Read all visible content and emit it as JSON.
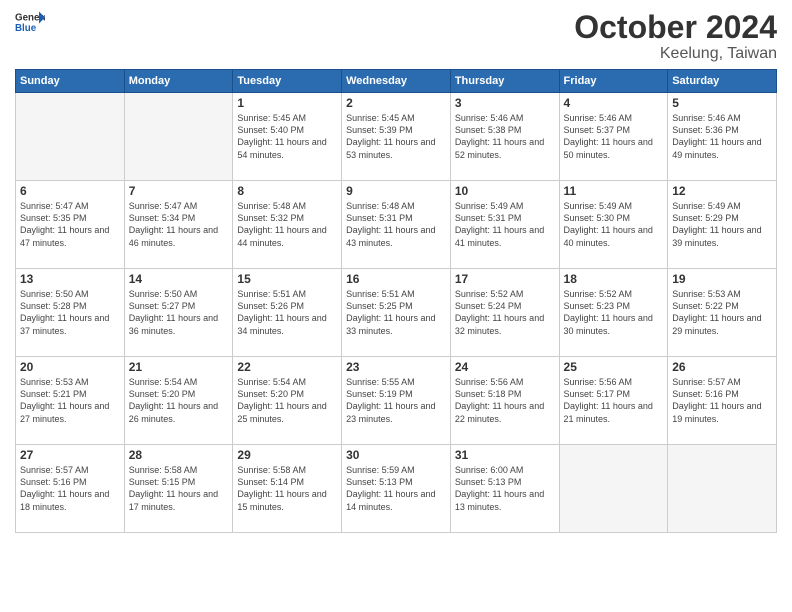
{
  "header": {
    "logo_general": "General",
    "logo_blue": "Blue",
    "month": "October 2024",
    "location": "Keelung, Taiwan"
  },
  "days_of_week": [
    "Sunday",
    "Monday",
    "Tuesday",
    "Wednesday",
    "Thursday",
    "Friday",
    "Saturday"
  ],
  "weeks": [
    [
      {
        "day": "",
        "sunrise": "",
        "sunset": "",
        "daylight": "",
        "empty": true
      },
      {
        "day": "",
        "sunrise": "",
        "sunset": "",
        "daylight": "",
        "empty": true
      },
      {
        "day": "1",
        "sunrise": "Sunrise: 5:45 AM",
        "sunset": "Sunset: 5:40 PM",
        "daylight": "Daylight: 11 hours and 54 minutes.",
        "empty": false
      },
      {
        "day": "2",
        "sunrise": "Sunrise: 5:45 AM",
        "sunset": "Sunset: 5:39 PM",
        "daylight": "Daylight: 11 hours and 53 minutes.",
        "empty": false
      },
      {
        "day": "3",
        "sunrise": "Sunrise: 5:46 AM",
        "sunset": "Sunset: 5:38 PM",
        "daylight": "Daylight: 11 hours and 52 minutes.",
        "empty": false
      },
      {
        "day": "4",
        "sunrise": "Sunrise: 5:46 AM",
        "sunset": "Sunset: 5:37 PM",
        "daylight": "Daylight: 11 hours and 50 minutes.",
        "empty": false
      },
      {
        "day": "5",
        "sunrise": "Sunrise: 5:46 AM",
        "sunset": "Sunset: 5:36 PM",
        "daylight": "Daylight: 11 hours and 49 minutes.",
        "empty": false
      }
    ],
    [
      {
        "day": "6",
        "sunrise": "Sunrise: 5:47 AM",
        "sunset": "Sunset: 5:35 PM",
        "daylight": "Daylight: 11 hours and 47 minutes.",
        "empty": false
      },
      {
        "day": "7",
        "sunrise": "Sunrise: 5:47 AM",
        "sunset": "Sunset: 5:34 PM",
        "daylight": "Daylight: 11 hours and 46 minutes.",
        "empty": false
      },
      {
        "day": "8",
        "sunrise": "Sunrise: 5:48 AM",
        "sunset": "Sunset: 5:32 PM",
        "daylight": "Daylight: 11 hours and 44 minutes.",
        "empty": false
      },
      {
        "day": "9",
        "sunrise": "Sunrise: 5:48 AM",
        "sunset": "Sunset: 5:31 PM",
        "daylight": "Daylight: 11 hours and 43 minutes.",
        "empty": false
      },
      {
        "day": "10",
        "sunrise": "Sunrise: 5:49 AM",
        "sunset": "Sunset: 5:31 PM",
        "daylight": "Daylight: 11 hours and 41 minutes.",
        "empty": false
      },
      {
        "day": "11",
        "sunrise": "Sunrise: 5:49 AM",
        "sunset": "Sunset: 5:30 PM",
        "daylight": "Daylight: 11 hours and 40 minutes.",
        "empty": false
      },
      {
        "day": "12",
        "sunrise": "Sunrise: 5:49 AM",
        "sunset": "Sunset: 5:29 PM",
        "daylight": "Daylight: 11 hours and 39 minutes.",
        "empty": false
      }
    ],
    [
      {
        "day": "13",
        "sunrise": "Sunrise: 5:50 AM",
        "sunset": "Sunset: 5:28 PM",
        "daylight": "Daylight: 11 hours and 37 minutes.",
        "empty": false
      },
      {
        "day": "14",
        "sunrise": "Sunrise: 5:50 AM",
        "sunset": "Sunset: 5:27 PM",
        "daylight": "Daylight: 11 hours and 36 minutes.",
        "empty": false
      },
      {
        "day": "15",
        "sunrise": "Sunrise: 5:51 AM",
        "sunset": "Sunset: 5:26 PM",
        "daylight": "Daylight: 11 hours and 34 minutes.",
        "empty": false
      },
      {
        "day": "16",
        "sunrise": "Sunrise: 5:51 AM",
        "sunset": "Sunset: 5:25 PM",
        "daylight": "Daylight: 11 hours and 33 minutes.",
        "empty": false
      },
      {
        "day": "17",
        "sunrise": "Sunrise: 5:52 AM",
        "sunset": "Sunset: 5:24 PM",
        "daylight": "Daylight: 11 hours and 32 minutes.",
        "empty": false
      },
      {
        "day": "18",
        "sunrise": "Sunrise: 5:52 AM",
        "sunset": "Sunset: 5:23 PM",
        "daylight": "Daylight: 11 hours and 30 minutes.",
        "empty": false
      },
      {
        "day": "19",
        "sunrise": "Sunrise: 5:53 AM",
        "sunset": "Sunset: 5:22 PM",
        "daylight": "Daylight: 11 hours and 29 minutes.",
        "empty": false
      }
    ],
    [
      {
        "day": "20",
        "sunrise": "Sunrise: 5:53 AM",
        "sunset": "Sunset: 5:21 PM",
        "daylight": "Daylight: 11 hours and 27 minutes.",
        "empty": false
      },
      {
        "day": "21",
        "sunrise": "Sunrise: 5:54 AM",
        "sunset": "Sunset: 5:20 PM",
        "daylight": "Daylight: 11 hours and 26 minutes.",
        "empty": false
      },
      {
        "day": "22",
        "sunrise": "Sunrise: 5:54 AM",
        "sunset": "Sunset: 5:20 PM",
        "daylight": "Daylight: 11 hours and 25 minutes.",
        "empty": false
      },
      {
        "day": "23",
        "sunrise": "Sunrise: 5:55 AM",
        "sunset": "Sunset: 5:19 PM",
        "daylight": "Daylight: 11 hours and 23 minutes.",
        "empty": false
      },
      {
        "day": "24",
        "sunrise": "Sunrise: 5:56 AM",
        "sunset": "Sunset: 5:18 PM",
        "daylight": "Daylight: 11 hours and 22 minutes.",
        "empty": false
      },
      {
        "day": "25",
        "sunrise": "Sunrise: 5:56 AM",
        "sunset": "Sunset: 5:17 PM",
        "daylight": "Daylight: 11 hours and 21 minutes.",
        "empty": false
      },
      {
        "day": "26",
        "sunrise": "Sunrise: 5:57 AM",
        "sunset": "Sunset: 5:16 PM",
        "daylight": "Daylight: 11 hours and 19 minutes.",
        "empty": false
      }
    ],
    [
      {
        "day": "27",
        "sunrise": "Sunrise: 5:57 AM",
        "sunset": "Sunset: 5:16 PM",
        "daylight": "Daylight: 11 hours and 18 minutes.",
        "empty": false
      },
      {
        "day": "28",
        "sunrise": "Sunrise: 5:58 AM",
        "sunset": "Sunset: 5:15 PM",
        "daylight": "Daylight: 11 hours and 17 minutes.",
        "empty": false
      },
      {
        "day": "29",
        "sunrise": "Sunrise: 5:58 AM",
        "sunset": "Sunset: 5:14 PM",
        "daylight": "Daylight: 11 hours and 15 minutes.",
        "empty": false
      },
      {
        "day": "30",
        "sunrise": "Sunrise: 5:59 AM",
        "sunset": "Sunset: 5:13 PM",
        "daylight": "Daylight: 11 hours and 14 minutes.",
        "empty": false
      },
      {
        "day": "31",
        "sunrise": "Sunrise: 6:00 AM",
        "sunset": "Sunset: 5:13 PM",
        "daylight": "Daylight: 11 hours and 13 minutes.",
        "empty": false
      },
      {
        "day": "",
        "sunrise": "",
        "sunset": "",
        "daylight": "",
        "empty": true
      },
      {
        "day": "",
        "sunrise": "",
        "sunset": "",
        "daylight": "",
        "empty": true
      }
    ]
  ]
}
